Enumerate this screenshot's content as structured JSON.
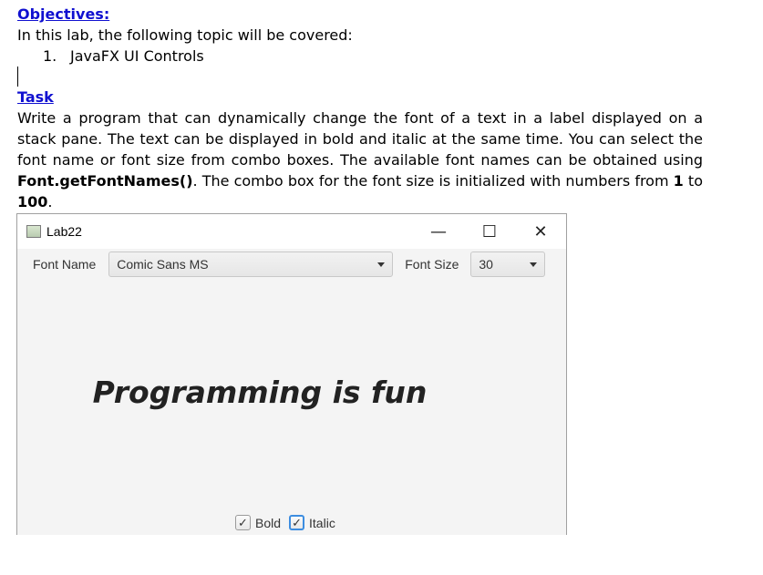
{
  "document": {
    "objectives_heading": "Objectives:",
    "intro": "In this lab, the following topic will be covered:",
    "list_number": "1.",
    "list_item": "JavaFX UI Controls",
    "task_heading": "Task",
    "task_text_1": "Write a program that can dynamically change the font of a text in a label displayed on a stack pane. The text can be displayed in bold and italic at the same time. You can select the font name or font size from combo boxes. The available font names can be obtained using ",
    "task_code": "Font.getFontNames()",
    "task_text_2": ". The combo box for the font size is initialized with numbers from ",
    "task_num_1": "1",
    "task_text_3": " to ",
    "task_num_2": "100",
    "task_text_4": "."
  },
  "window": {
    "title": "Lab22",
    "minimize_glyph": "—",
    "maximize_glyph": "☐",
    "close_glyph": "✕",
    "font_name_label": "Font Name",
    "font_name_value": "Comic Sans MS",
    "font_size_label": "Font Size",
    "font_size_value": "30",
    "sample_text": "Programming is fun",
    "bold_label": "Bold",
    "italic_label": "Italic",
    "bold_checked": true,
    "italic_checked": true,
    "check_glyph": "✓"
  },
  "colors": {
    "heading_link": "#1010d0",
    "focus_ring": "#3d8de0",
    "window_background": "#f4f4f4"
  }
}
